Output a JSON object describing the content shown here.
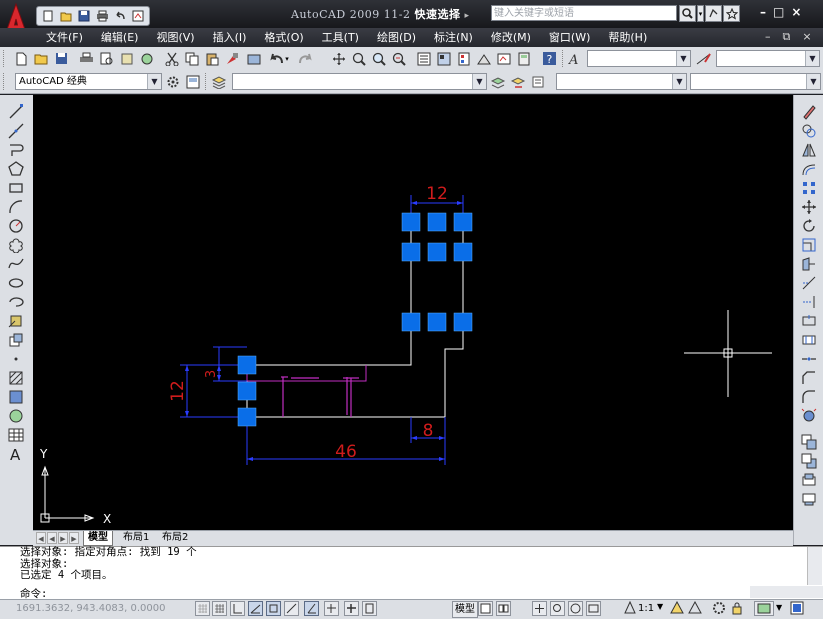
{
  "app": {
    "title_prefix": "AutoCAD 2009",
    "drawing": "11-2",
    "command_title": "快速选择",
    "search_placeholder": "键入关键字或短语",
    "win_min": "–",
    "win_max": "□",
    "win_close": "×"
  },
  "menu": {
    "items": [
      "文件(F)",
      "编辑(E)",
      "视图(V)",
      "插入(I)",
      "格式(O)",
      "工具(T)",
      "绘图(D)",
      "标注(N)",
      "修改(M)",
      "窗口(W)",
      "帮助(H)"
    ],
    "doc_min": "–",
    "doc_restore": "⧉",
    "doc_close": "×"
  },
  "toolbar": {
    "workspace": "AutoCAD 经典"
  },
  "drawing": {
    "dim_top": "12",
    "dim_left_small": "3",
    "dim_left": "12",
    "dim_right": "8",
    "dim_bottom": "46",
    "ucs_x": "X",
    "ucs_y": "Y"
  },
  "tabs": [
    "模型",
    "布局1",
    "布局2"
  ],
  "command": {
    "lines": [
      "选择对象: 指定对角点: 找到 19 个",
      "选择对象:",
      "已选定 4 个项目。"
    ],
    "prompt": "命令:"
  },
  "status": {
    "coords": "1691.3632, 943.4083, 0.0000",
    "model_label": "模型",
    "annotation_scale": "1:1"
  },
  "colors": {
    "canvas": "#000000",
    "grip": "#0a6ee8",
    "dimension": "#d01c1c",
    "dim_line": "#2a3cff",
    "geometry": "#ffffff",
    "hatch": "#c22ec2"
  }
}
